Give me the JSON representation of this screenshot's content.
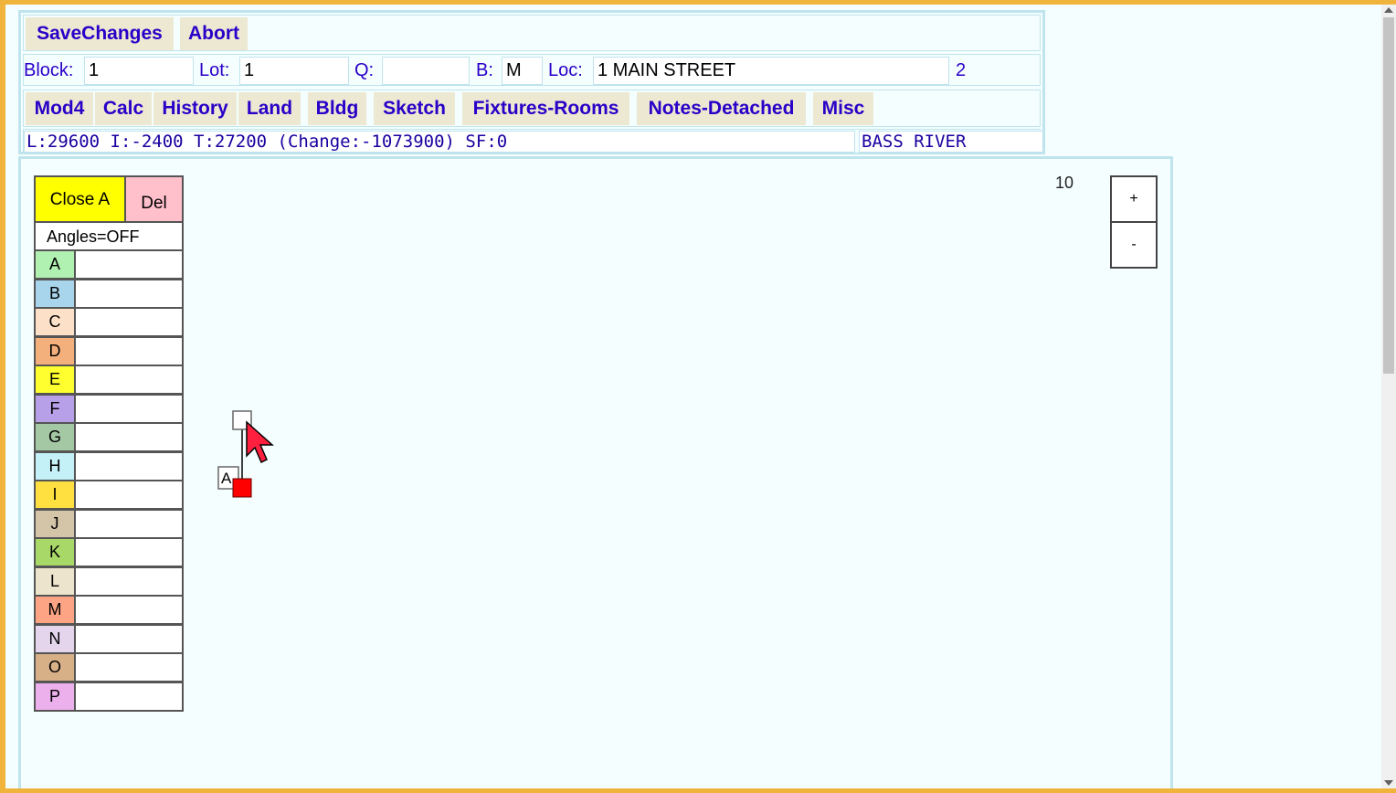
{
  "toolbar": {
    "save_label": "SaveChanges",
    "abort_label": "Abort"
  },
  "parcel": {
    "block_label": "Block:",
    "block_value": "1",
    "lot_label": "Lot:",
    "lot_value": "1",
    "q_label": "Q:",
    "q_value": "",
    "b_label": "B:",
    "b_value": "M",
    "loc_label": "Loc:",
    "loc_value": "1 MAIN STREET",
    "card_number": "2"
  },
  "nav": {
    "tabs": [
      "Mod4",
      "Calc",
      "History",
      "Land",
      "Bldg",
      "Sketch",
      "Fixtures-Rooms",
      "Notes-Detached",
      "Misc"
    ]
  },
  "summary": {
    "values_text": "L:29600 I:-2400 T:27200 (Change:-1073900) SF:0",
    "town": "BASS RIVER"
  },
  "sketch": {
    "scale": "10",
    "zoom_in_label": "+",
    "zoom_out_label": "-",
    "close_label": "Close A",
    "del_label": "Del",
    "angles_label": "Angles=OFF",
    "point_label": "A",
    "segments": [
      {
        "letter": "A",
        "color": "#b0f0b0",
        "value": ""
      },
      {
        "letter": "B",
        "color": "#a8d4ec",
        "value": ""
      },
      {
        "letter": "C",
        "color": "#fde0c8",
        "value": ""
      },
      {
        "letter": "D",
        "color": "#f4b07c",
        "value": ""
      },
      {
        "letter": "E",
        "color": "#ffff30",
        "value": ""
      },
      {
        "letter": "F",
        "color": "#b8a0e8",
        "value": ""
      },
      {
        "letter": "G",
        "color": "#a4c8a4",
        "value": ""
      },
      {
        "letter": "H",
        "color": "#c4f0f8",
        "value": ""
      },
      {
        "letter": "I",
        "color": "#ffe040",
        "value": ""
      },
      {
        "letter": "J",
        "color": "#d4c4a8",
        "value": ""
      },
      {
        "letter": "K",
        "color": "#a8d868",
        "value": ""
      },
      {
        "letter": "L",
        "color": "#ece4cc",
        "value": ""
      },
      {
        "letter": "M",
        "color": "#fca484",
        "value": ""
      },
      {
        "letter": "N",
        "color": "#e4d4ec",
        "value": ""
      },
      {
        "letter": "O",
        "color": "#d8b088",
        "value": ""
      },
      {
        "letter": "P",
        "color": "#ecb0ec",
        "value": ""
      }
    ],
    "colors": {
      "active_vertex": "#ff0000",
      "cursor": "#ff2040"
    }
  }
}
